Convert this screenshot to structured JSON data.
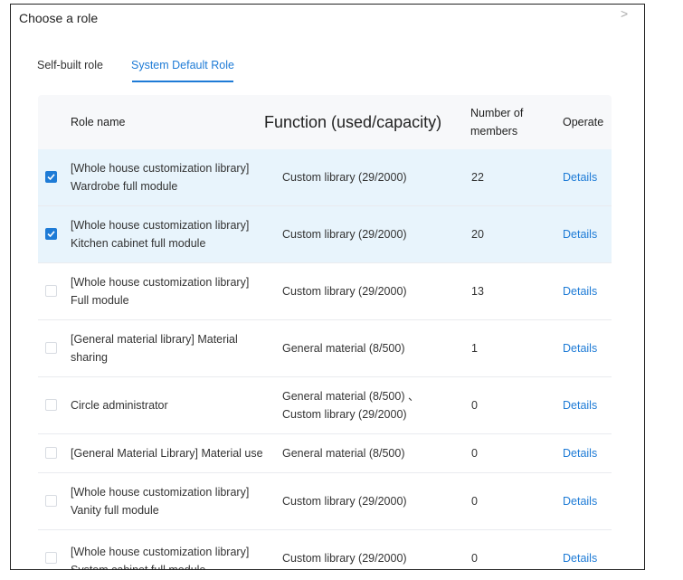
{
  "dialog": {
    "title": "Choose a role",
    "close_symbol": ">"
  },
  "tabs": [
    {
      "label": "Self-built role",
      "active": false
    },
    {
      "label": "System Default Role",
      "active": true
    }
  ],
  "table": {
    "headers": {
      "role_name": "Role name",
      "function": "Function (used/capacity)",
      "members_line1": "Number of",
      "members_line2": "members",
      "operate": "Operate"
    },
    "rows": [
      {
        "checked": true,
        "role": [
          "[Whole house customization library]",
          "Wardrobe full module"
        ],
        "function": [
          "Custom library  (29/2000)"
        ],
        "members": "22",
        "action": "Details"
      },
      {
        "checked": true,
        "role": [
          "[Whole house customization library]",
          "Kitchen cabinet full module"
        ],
        "function": [
          "Custom library  (29/2000)"
        ],
        "members": "20",
        "action": "Details"
      },
      {
        "checked": false,
        "role": [
          "[Whole house customization library]",
          "Full module"
        ],
        "function": [
          "Custom library  (29/2000)"
        ],
        "members": "13",
        "action": "Details"
      },
      {
        "checked": false,
        "role": [
          "[General material library] Material",
          "sharing"
        ],
        "function": [
          "General material  (8/500)"
        ],
        "members": "1",
        "action": "Details"
      },
      {
        "checked": false,
        "role": [
          "Circle administrator"
        ],
        "function": [
          "General material  (8/500) 、",
          "Custom library  (29/2000)"
        ],
        "members": "0",
        "action": "Details"
      },
      {
        "checked": false,
        "role": [
          "[General Material Library] Material use"
        ],
        "function": [
          "General material  (8/500)"
        ],
        "members": "0",
        "action": "Details"
      },
      {
        "checked": false,
        "role": [
          "[Whole house customization library]",
          "Vanity full module"
        ],
        "function": [
          "Custom library  (29/2000)"
        ],
        "members": "0",
        "action": "Details"
      },
      {
        "checked": false,
        "role": [
          "[Whole house customization library]",
          "System cabinet full module"
        ],
        "function": [
          "Custom library  (29/2000)"
        ],
        "members": "0",
        "action": "Details"
      }
    ]
  },
  "colors": {
    "accent": "#1e7bd6",
    "selected_row_bg": "#e8f4fc",
    "header_bg": "#f7f8fa"
  }
}
